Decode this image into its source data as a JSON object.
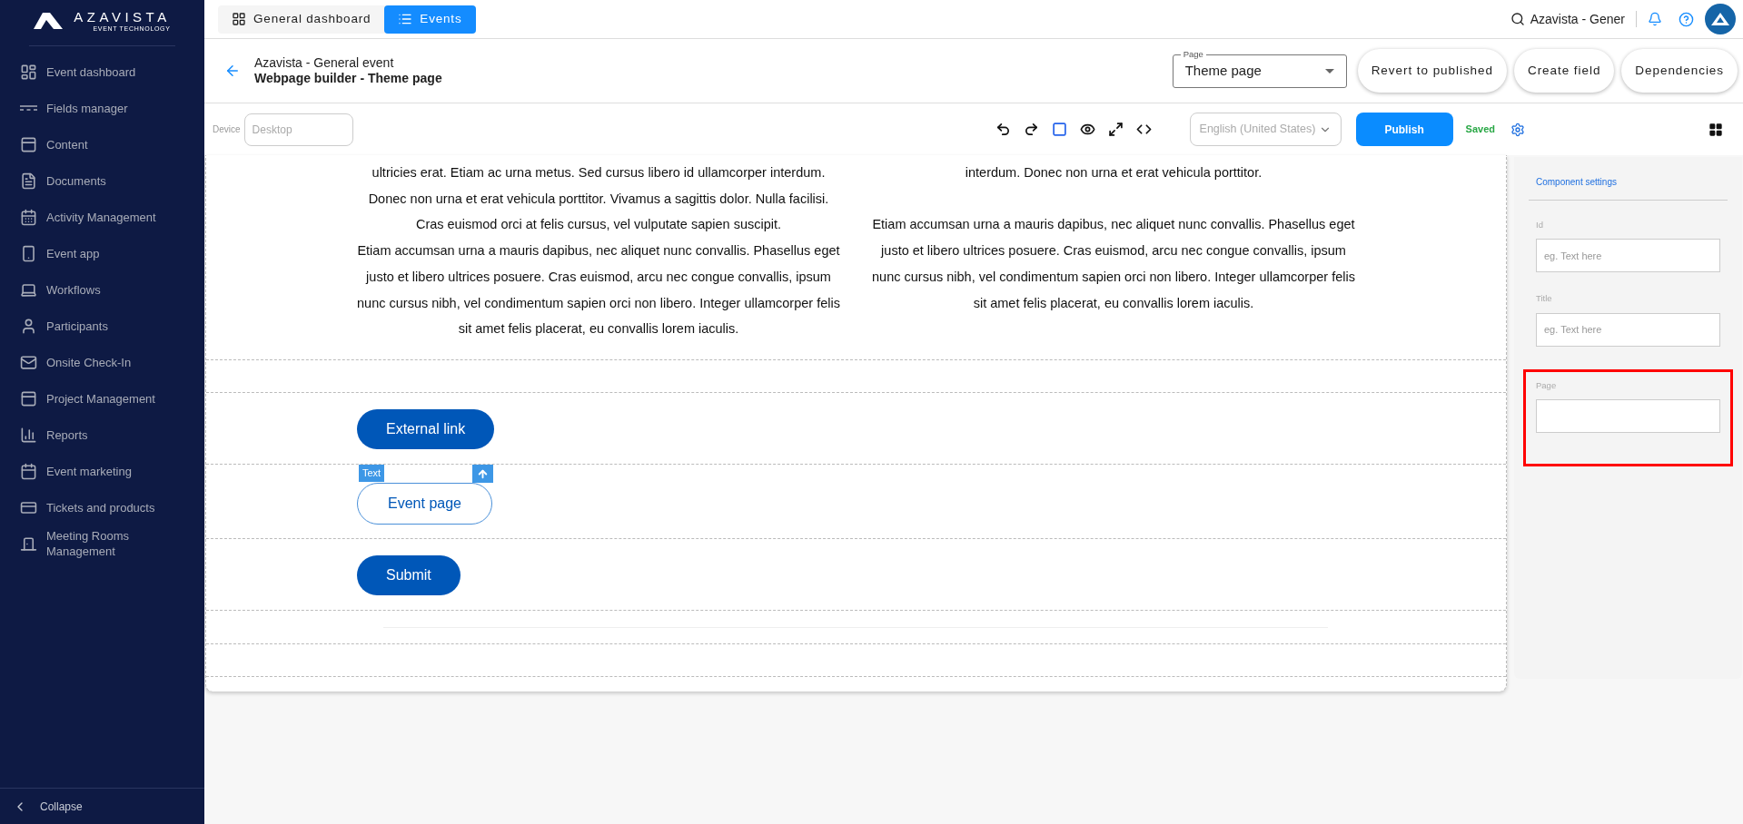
{
  "sidebar": {
    "logo": {
      "name": "AZAVISTA",
      "tagline": "EVENT TECHNOLOGY"
    },
    "items": [
      {
        "label": "Event dashboard",
        "selected": false
      },
      {
        "label": "Fields manager",
        "selected": false
      },
      {
        "label": "Content",
        "selected": false
      },
      {
        "label": "Documents",
        "selected": false
      },
      {
        "label": "Activity Management",
        "selected": false
      },
      {
        "label": "Event app",
        "selected": false
      },
      {
        "label": "Workflows",
        "selected": false
      },
      {
        "label": "Participants",
        "selected": false
      },
      {
        "label": "Onsite Check-In",
        "selected": false
      },
      {
        "label": "Project Management",
        "selected": false
      },
      {
        "label": "Reports",
        "selected": false
      },
      {
        "label": "Event marketing",
        "selected": false
      },
      {
        "label": "Tickets and products",
        "selected": false
      },
      {
        "label": "Meeting Rooms Management",
        "selected": false
      }
    ],
    "collapse": "Collapse"
  },
  "top_bar": {
    "tabs": [
      {
        "label": "General dashboard",
        "selected": false
      },
      {
        "label": "Events",
        "selected": true
      }
    ],
    "search_text": "Azavista - Gener"
  },
  "header": {
    "event_name": "Azavista - General event",
    "page_title": "Webpage builder - Theme page",
    "page_select": {
      "label": "Page",
      "value": "Theme page"
    },
    "buttons": [
      "Revert to published",
      "Create field",
      "Dependencies"
    ]
  },
  "toolbar": {
    "device_label": "Device",
    "device_placeholder": "Desktop",
    "language": "English (United States)",
    "publish": "Publish",
    "status": "Saved"
  },
  "canvas": {
    "sections": [
      {
        "kind": "text_columns",
        "columns": [
          {
            "paragraphs": [
              {
                "lines": [
                  "ultricies erat. Etiam ac urna metus. Sed cursus libero id ullamcorper interdum.",
                  "Donec non urna et erat vehicula porttitor. Vivamus a sagittis dolor. Nulla facilisi.",
                  "Cras euismod orci at felis cursus, vel vulputate sapien suscipit.",
                  "Etiam accumsan urna a mauris dapibus, nec aliquet nunc convallis. Phasellus eget",
                  "justo et libero ultrices posuere. Cras euismod, arcu nec congue convallis, ipsum",
                  "nunc cursus nibh, vel condimentum sapien orci non libero. Integer ullamcorper felis",
                  "sit amet felis placerat, eu convallis lorem iaculis."
                ]
              }
            ]
          },
          {
            "paragraphs": [
              {
                "lines": [
                  "interdum. Donec non urna et erat vehicula porttitor."
                ]
              },
              {
                "lines": [
                  "Etiam accumsan urna a mauris dapibus, nec aliquet nunc convallis. Phasellus eget",
                  "justo et libero ultrices posuere. Cras euismod, arcu nec congue convallis, ipsum",
                  "nunc cursus nibh, vel condimentum sapien orci non libero. Integer ullamcorper felis",
                  "sit amet felis placerat, eu convallis lorem iaculis."
                ]
              }
            ]
          }
        ]
      },
      {
        "kind": "empty"
      },
      {
        "kind": "filled_button",
        "label": "External link",
        "selected": false
      },
      {
        "kind": "outline_button",
        "label": "Event page",
        "selected": true,
        "tag": "Text"
      },
      {
        "kind": "filled_button",
        "label": "Submit",
        "selected": false
      },
      {
        "kind": "divider"
      },
      {
        "kind": "empty"
      }
    ]
  },
  "settings": {
    "title": "Component settings",
    "fields": [
      {
        "label": "Id",
        "placeholder": "eg. Text here",
        "highlighted": false
      },
      {
        "label": "Title",
        "placeholder": "eg. Text here",
        "highlighted": false
      },
      {
        "label": "Page",
        "highlighted": true
      }
    ]
  }
}
